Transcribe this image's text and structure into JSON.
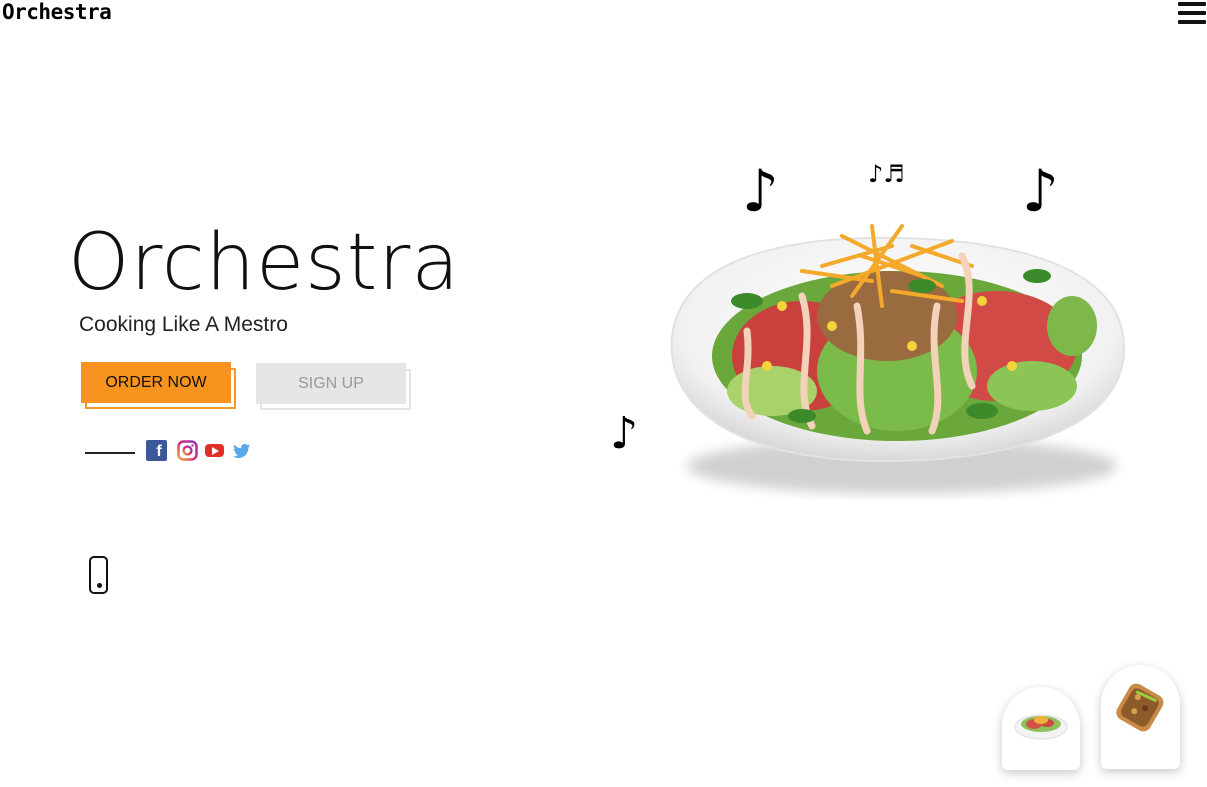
{
  "header": {
    "brand": "Orchestra",
    "menu_icon": "hamburger-menu-icon"
  },
  "hero": {
    "title": "Orchestra",
    "subtitle": "Cooking Like A Mestro",
    "order_button": "ORDER NOW",
    "signup_button": "SIGN UP"
  },
  "social": {
    "icons": [
      "facebook-icon",
      "instagram-icon",
      "youtube-icon",
      "twitter-icon"
    ],
    "facebook_glyph": "f"
  },
  "decor": {
    "note_single": "♪",
    "note_pair": "♪♬"
  },
  "cards": [
    {
      "name": "salad-thumbnail"
    },
    {
      "name": "toast-thumbnail"
    }
  ],
  "colors": {
    "accent": "#f7931e",
    "secondary_button": "#e6e6e6",
    "facebook": "#3b5998",
    "youtube": "#e52d27",
    "twitter": "#55acee"
  }
}
